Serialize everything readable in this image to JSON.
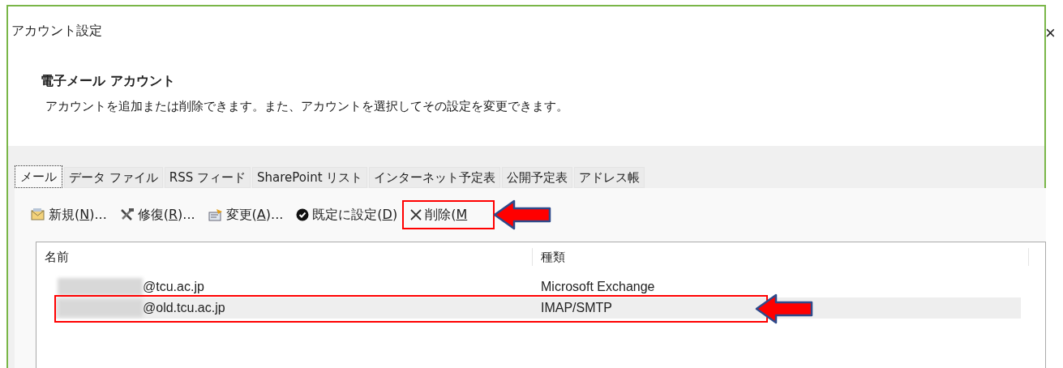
{
  "window": {
    "title": "アカウント設定",
    "close": "×"
  },
  "header": {
    "title": "電子メール アカウント",
    "description": "アカウントを追加または削除できます。また、アカウントを選択してその設定を変更できます。"
  },
  "tabs": [
    {
      "label": "メール",
      "selected": true
    },
    {
      "label": "データ ファイル",
      "selected": false
    },
    {
      "label": "RSS フィード",
      "selected": false
    },
    {
      "label": "SharePoint リスト",
      "selected": false
    },
    {
      "label": "インターネット予定表",
      "selected": false
    },
    {
      "label": "公開予定表",
      "selected": false
    },
    {
      "label": "アドレス帳",
      "selected": false
    }
  ],
  "toolbar": [
    {
      "kind": "new",
      "before": "新規(",
      "key": "N",
      "after": ")..."
    },
    {
      "kind": "repair",
      "before": "修復(",
      "key": "R",
      "after": ")..."
    },
    {
      "kind": "change",
      "before": "変更(",
      "key": "A",
      "after": ")..."
    },
    {
      "kind": "default",
      "before": "既定に設定(",
      "key": "D",
      "after": ")"
    },
    {
      "kind": "delete",
      "before": "削除(",
      "key": "M"
    }
  ],
  "table": {
    "columns": [
      "名前",
      "種類"
    ],
    "rows": [
      {
        "name": "@tcu.ac.jp",
        "type": "Microsoft Exchange",
        "selected": false
      },
      {
        "name": "@old.tcu.ac.jp",
        "type": "IMAP/SMTP",
        "selected": true
      }
    ]
  }
}
